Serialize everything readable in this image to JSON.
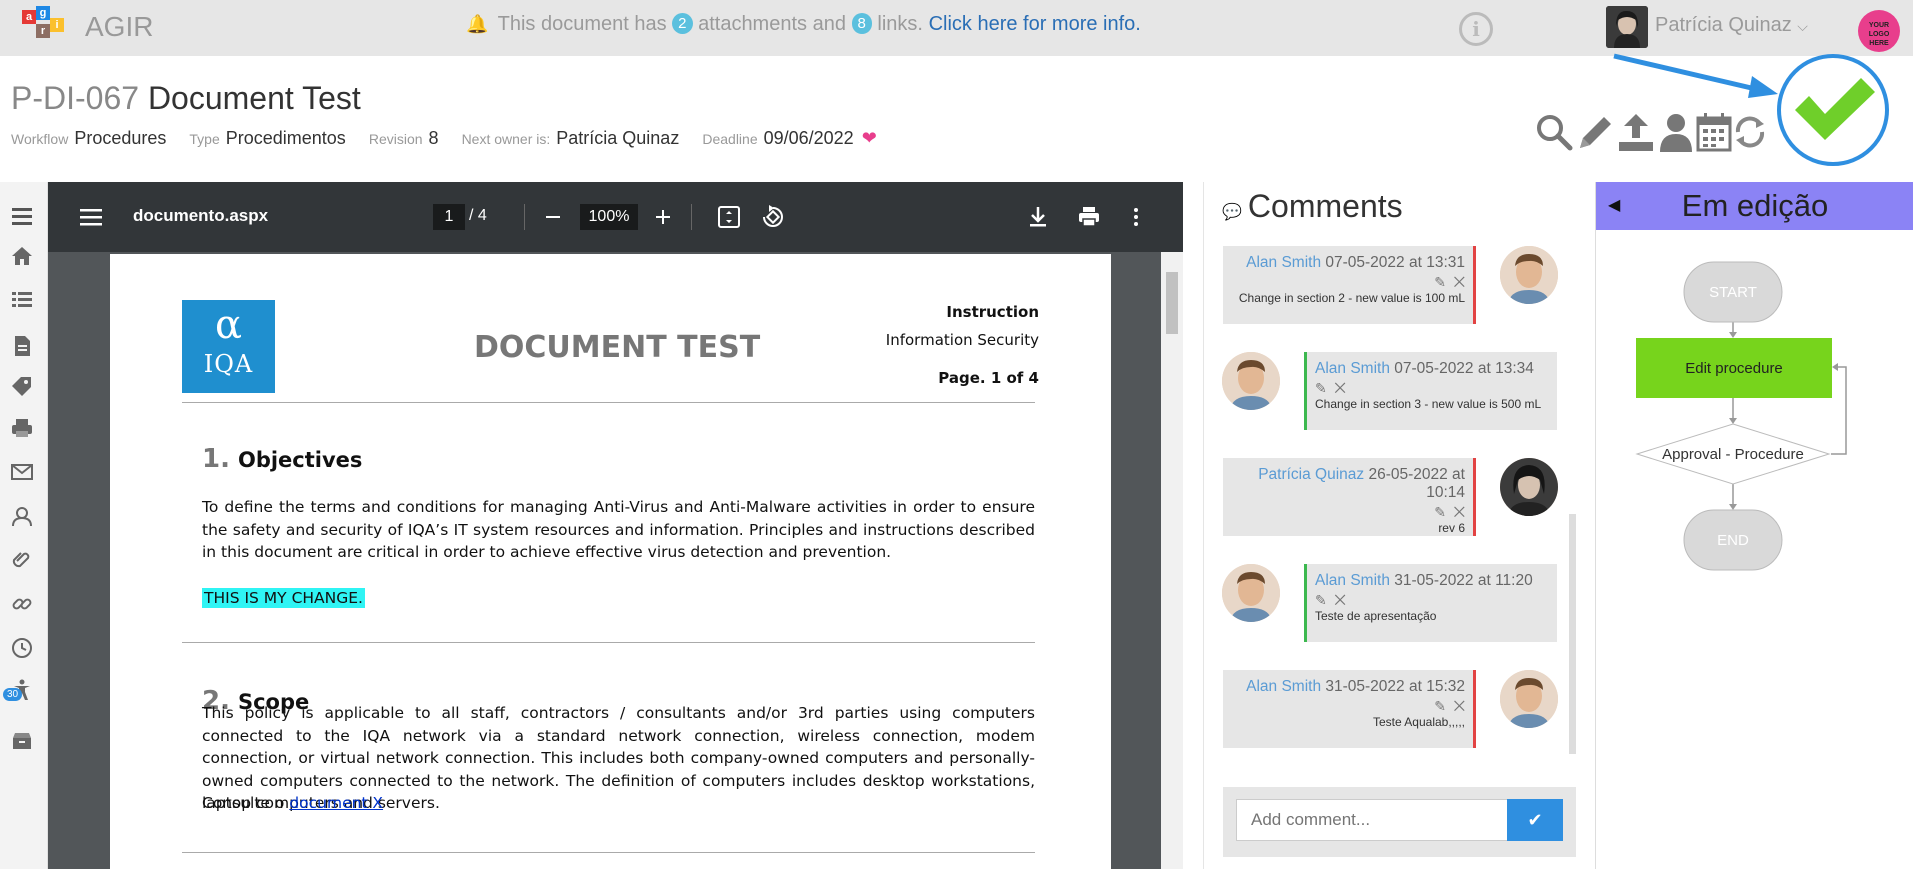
{
  "app": {
    "name": "AGIR",
    "logo_letters": [
      "a",
      "g",
      "i",
      "r"
    ]
  },
  "notice": {
    "prefix": "This document has",
    "attachments": "2",
    "middle": "attachments and",
    "links": "8",
    "suffix": "links.",
    "link_text": "Click here for more info."
  },
  "user": {
    "name": "Patrícia Quinaz"
  },
  "company_logo": "YOUR LOGO HERE",
  "document": {
    "code": "P-DI-067",
    "title": "Document Test",
    "meta": {
      "workflow_label": "Workflow",
      "workflow": "Procedures",
      "type_label": "Type",
      "type": "Procedimentos",
      "revision_label": "Revision",
      "revision": "8",
      "owner_label": "Next owner is:",
      "owner": "Patrícia Quinaz",
      "deadline_label": "Deadline",
      "deadline": "09/06/2022"
    }
  },
  "toolbar_icons": [
    "search-icon",
    "pencil-icon",
    "upload-icon",
    "user-icon",
    "calendar-icon",
    "refresh-icon",
    "check-icon"
  ],
  "sidebar_icons": [
    "menu-icon",
    "home-icon",
    "list-icon",
    "document-icon",
    "tags-icon",
    "print-icon",
    "mail-icon",
    "contacts-icon",
    "paperclip-icon",
    "link-icon",
    "clock-icon",
    "accessibility-icon",
    "archive-icon"
  ],
  "sidebar_badge": "30",
  "pdf": {
    "filename": "documento.aspx",
    "page": "1",
    "total": "/ 4",
    "zoom": "100%",
    "header": {
      "logo_text": "IQA",
      "title": "DOCUMENT TEST",
      "line1": "Instruction",
      "line2": "Information Security",
      "line3": "Page. 1 of 4"
    },
    "sections": [
      {
        "num": "1.",
        "title": "Objectives",
        "body": "To define the terms and conditions for managing Anti-Virus and Anti-Malware activities in order to ensure the safety and security of IQA’s IT system resources and information. Principles and instructions described in this document are critical in order to achieve effective virus detection and prevention."
      },
      {
        "num": "2.",
        "title": "Scope",
        "body": "This policy is applicable to all staff, contractors / consultants and/or 3rd parties using computers connected to the IQA network via a standard network connection, wireless connection, modem connection, or virtual network connection. This includes both company-owned computers and personally-owned computers connected to the network. The definition of computers includes desktop workstations, laptop computers and servers."
      }
    ],
    "change_text": "THIS IS MY CHANGE.",
    "consult_prefix": "Consulte o",
    "consult_link": "document X"
  },
  "comments": {
    "title": "Comments",
    "items": [
      {
        "who": "Alan Smith",
        "when": "07-05-2022 at 13:31",
        "text": "Change in section 2 - new value is 100 mL",
        "side": "right"
      },
      {
        "who": "Alan Smith",
        "when": "07-05-2022 at 13:34",
        "text": "Change in section 3 - new value is 500 mL",
        "side": "left"
      },
      {
        "who": "Patrícia Quinaz",
        "when": "26-05-2022 at 10:14",
        "text": "rev 6",
        "side": "right"
      },
      {
        "who": "Alan Smith",
        "when": "31-05-2022 at 11:20",
        "text": "Teste de apresentação",
        "side": "left"
      },
      {
        "who": "Alan Smith",
        "when": "31-05-2022 at 15:32",
        "text": "Teste Aqualab,,,,,",
        "side": "right"
      }
    ],
    "input_placeholder": "Add comment..."
  },
  "workflow": {
    "status": "Em edição",
    "nodes": {
      "start": "START",
      "edit": "Edit procedure",
      "approval": "Approval - Procedure",
      "end": "END"
    },
    "colors": {
      "header": "#8b83f5",
      "active": "#77d41c",
      "inactive": "#d9d9d9"
    }
  }
}
